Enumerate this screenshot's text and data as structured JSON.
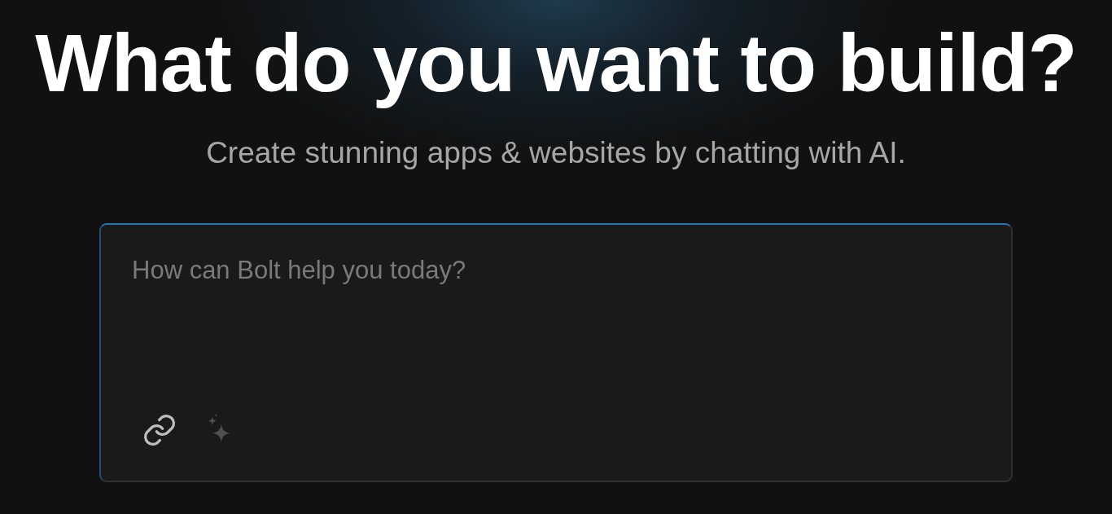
{
  "hero": {
    "title": "What do you want to build?",
    "subtitle": "Create stunning apps & websites by chatting with AI."
  },
  "prompt": {
    "placeholder": "How can Bolt help you today?"
  },
  "tools": [
    {
      "kind": "attach",
      "disabled": false
    },
    {
      "kind": "enhance",
      "disabled": true
    }
  ]
}
